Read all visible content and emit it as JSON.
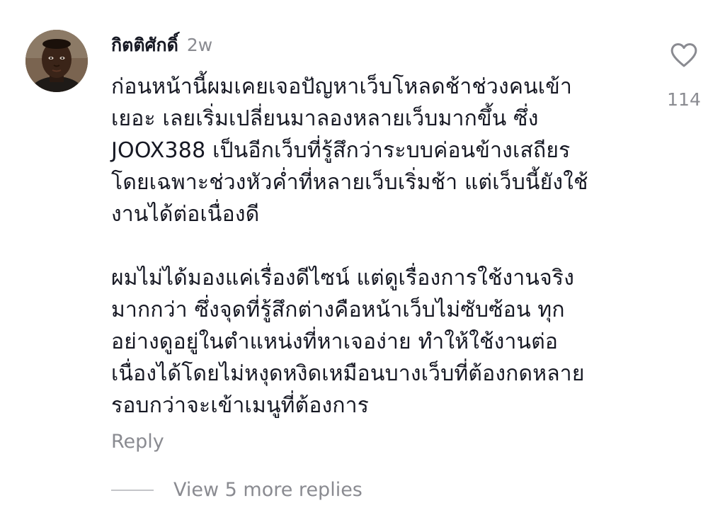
{
  "comment": {
    "username": "กิตติศักดิ์",
    "timestamp": "2w",
    "text": "ก่อนหน้านี้ผมเคยเจอปัญหาเว็บโหลดช้าช่วงคนเข้า\nเยอะ เลยเริ่มเปลี่ยนมาลองหลายเว็บมากขึ้น ซึ่ง\nJOOX388 เป็นอีกเว็บที่รู้สึกว่าระบบค่อนข้างเสถียร\nโดยเฉพาะช่วงหัวค่ำที่หลายเว็บเริ่มช้า แต่เว็บนี้ยังใช้\nงานได้ต่อเนื่องดี\n\nผมไม่ได้มองแค่เรื่องดีไซน์ แต่ดูเรื่องการใช้งานจริง\nมากกว่า ซึ่งจุดที่รู้สึกต่างคือหน้าเว็บไม่ซับซ้อน ทุก\nอย่างดูอยู่ในตำแหน่งที่หาเจอง่าย ทำให้ใช้งานต่อ\nเนื่องได้โดยไม่หงุดหงิดเหมือนบางเว็บที่ต้องกดหลาย\nรอบกว่าจะเข้าเมนูที่ต้องการ",
    "reply_label": "Reply",
    "view_replies_label": "View 5 more replies",
    "like_count": "114",
    "like_icon": "heart-outline-icon"
  },
  "colors": {
    "text_primary": "#161823",
    "text_secondary": "#8a8b91",
    "divider": "#c4c5c9",
    "background": "#ffffff"
  }
}
